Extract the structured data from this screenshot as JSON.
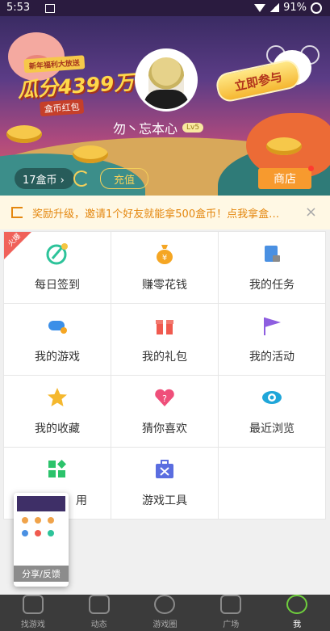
{
  "status_bar": {
    "time": "5:53",
    "battery": "91%"
  },
  "banner": {
    "promo_tag": "新年福利大放送",
    "promo_big": "瓜分4399万",
    "promo_sub": "盒币红包",
    "join_button": "立即参与",
    "username": "勿丶忘本心",
    "level": "Lv5",
    "coins": "17盒币 ›",
    "charge_button": "充值",
    "shop_button": "商店"
  },
  "notice": {
    "text": "奖励升级，邀请1个好友就能拿500盒币！点我拿盒…",
    "close": "×"
  },
  "grid": {
    "hot_badge": "火爆",
    "items": [
      {
        "label": "每日签到",
        "icon": "checkin-icon",
        "color": "#2dc39a"
      },
      {
        "label": "赚零花钱",
        "icon": "money-bag-icon",
        "color": "#f5a623"
      },
      {
        "label": "我的任务",
        "icon": "clipboard-lock-icon",
        "color": "#4a90e2"
      },
      {
        "label": "我的游戏",
        "icon": "gamepad-icon",
        "color": "#3b8fe8"
      },
      {
        "label": "我的礼包",
        "icon": "gift-icon",
        "color": "#f05a4f"
      },
      {
        "label": "我的活动",
        "icon": "flag-icon",
        "color": "#8e5ee0"
      },
      {
        "label": "我的收藏",
        "icon": "star-icon",
        "color": "#f5b82e"
      },
      {
        "label": "猜你喜欢",
        "icon": "heart-question-icon",
        "color": "#ef4f7a"
      },
      {
        "label": "最近浏览",
        "icon": "eye-icon",
        "color": "#1fa6d9"
      },
      {
        "label": "用",
        "icon": "apps-icon",
        "color": "#2cc36b"
      },
      {
        "label": "游戏工具",
        "icon": "toolbox-icon",
        "color": "#5a6de0"
      }
    ]
  },
  "float_card": {
    "label": "分享/反馈"
  },
  "bottom_nav": [
    {
      "label": "找游戏",
      "icon": "gamepad-outline-icon"
    },
    {
      "label": "动态",
      "icon": "footprint-icon"
    },
    {
      "label": "游戏圈",
      "icon": "circle-slash-icon"
    },
    {
      "label": "广场",
      "icon": "molecule-icon"
    },
    {
      "label": "我",
      "icon": "person-icon",
      "active": true
    }
  ]
}
